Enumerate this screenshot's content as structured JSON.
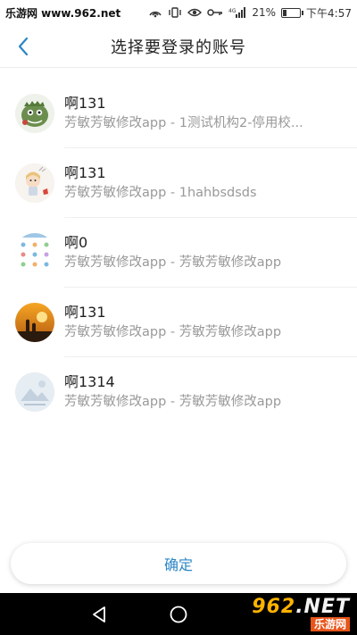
{
  "status_bar": {
    "site_label": "乐游网 www.962.net",
    "battery": "21%",
    "battery_level": 0.21,
    "time": "下午4:57"
  },
  "header": {
    "title": "选择要登录的账号",
    "back_icon": "chevron-left-icon"
  },
  "accounts": [
    {
      "name": "啊131",
      "subtitle": "芳敏芳敏修改app - 1测试机构2-停用校..."
    },
    {
      "name": "啊131",
      "subtitle": "芳敏芳敏修改app - 1hahbsdsds"
    },
    {
      "name": "啊0",
      "subtitle": "芳敏芳敏修改app - 芳敏芳敏修改app"
    },
    {
      "name": "啊131",
      "subtitle": "芳敏芳敏修改app - 芳敏芳敏修改app"
    },
    {
      "name": "啊1314",
      "subtitle": "芳敏芳敏修改app - 芳敏芳敏修改app"
    }
  ],
  "confirm_label": "确定",
  "watermark": {
    "big": "962",
    "net": ".NET",
    "small": "乐游网"
  },
  "colors": {
    "accent": "#2b86c5",
    "subtitle": "#999999",
    "navbar": "#000000"
  }
}
